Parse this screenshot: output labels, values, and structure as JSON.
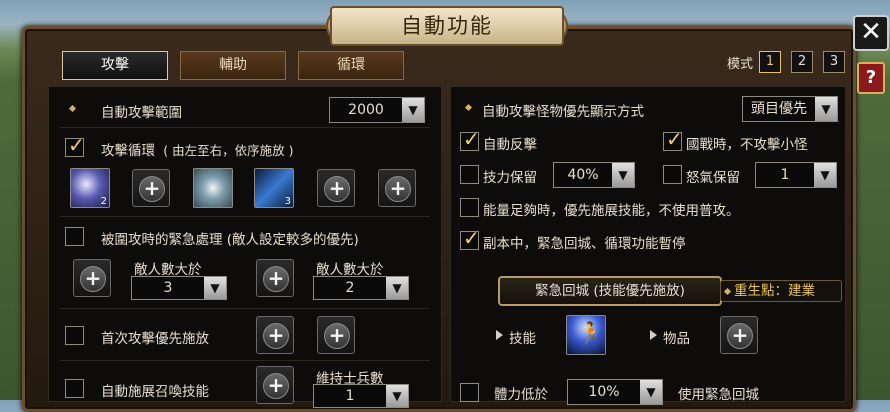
{
  "window": {
    "title": "自動功能"
  },
  "tabs": [
    {
      "label": "攻擊",
      "active": true
    },
    {
      "label": "輔助",
      "active": false
    },
    {
      "label": "循環",
      "active": false
    }
  ],
  "mode": {
    "label": "模式",
    "options": [
      "1",
      "2",
      "3"
    ],
    "selected": "1"
  },
  "left": {
    "range_label": "自動攻擊範圍",
    "range_value": "2000",
    "cycle_label": "攻擊循環",
    "cycle_hint": "( 由左至右，依序施放 )",
    "cycle_checked": true,
    "skill_numbers": [
      "2",
      "3"
    ],
    "surrounded_label": "被圍攻時的緊急處理 (敵人設定較多的優先)",
    "surrounded_checked": false,
    "enemy_label_1": "敵人數大於",
    "enemy_value_1": "3",
    "enemy_label_2": "敵人數大於",
    "enemy_value_2": "2",
    "first_attack_label": "首次攻擊優先施放",
    "first_attack_checked": false,
    "summon_label": "自動施展召喚技能",
    "summon_checked": false,
    "maintain_label": "維持士兵數",
    "maintain_value": "1"
  },
  "right": {
    "monster_display_label": "自動攻擊怪物優先顯示方式",
    "monster_display_value": "頭目優先",
    "counter_label": "自動反擊",
    "counter_checked": true,
    "nation_war_label": "國戰時，不攻擊小怪",
    "nation_war_checked": true,
    "skill_reserve_label": "技力保留",
    "skill_reserve_checked": false,
    "skill_reserve_value": "40%",
    "rage_reserve_label": "怒氣保留",
    "rage_reserve_checked": false,
    "rage_reserve_value": "1",
    "energy_label": "能量足夠時，優先施展技能，不使用普攻。",
    "energy_checked": false,
    "dungeon_label": "副本中，緊急回城、循環功能暫停",
    "dungeon_checked": true,
    "emergency_banner": "緊急回城 (技能優先施放)",
    "respawn_label": "重生點：建業",
    "skill_label": "技能",
    "item_label": "物品",
    "hp_low_label": "體力低於",
    "hp_low_checked": false,
    "hp_low_value": "10%",
    "use_emergency_label": "使用緊急回城"
  },
  "colors": {
    "accent": "#e9c45a",
    "check": "#f0d36a",
    "frame": "#6b4e2c"
  },
  "icons": {
    "close": "close-icon",
    "help": "question-icon",
    "checkbox": "checkmark-icon",
    "dropdown": "chevron-down-icon",
    "add": "plus-icon"
  }
}
